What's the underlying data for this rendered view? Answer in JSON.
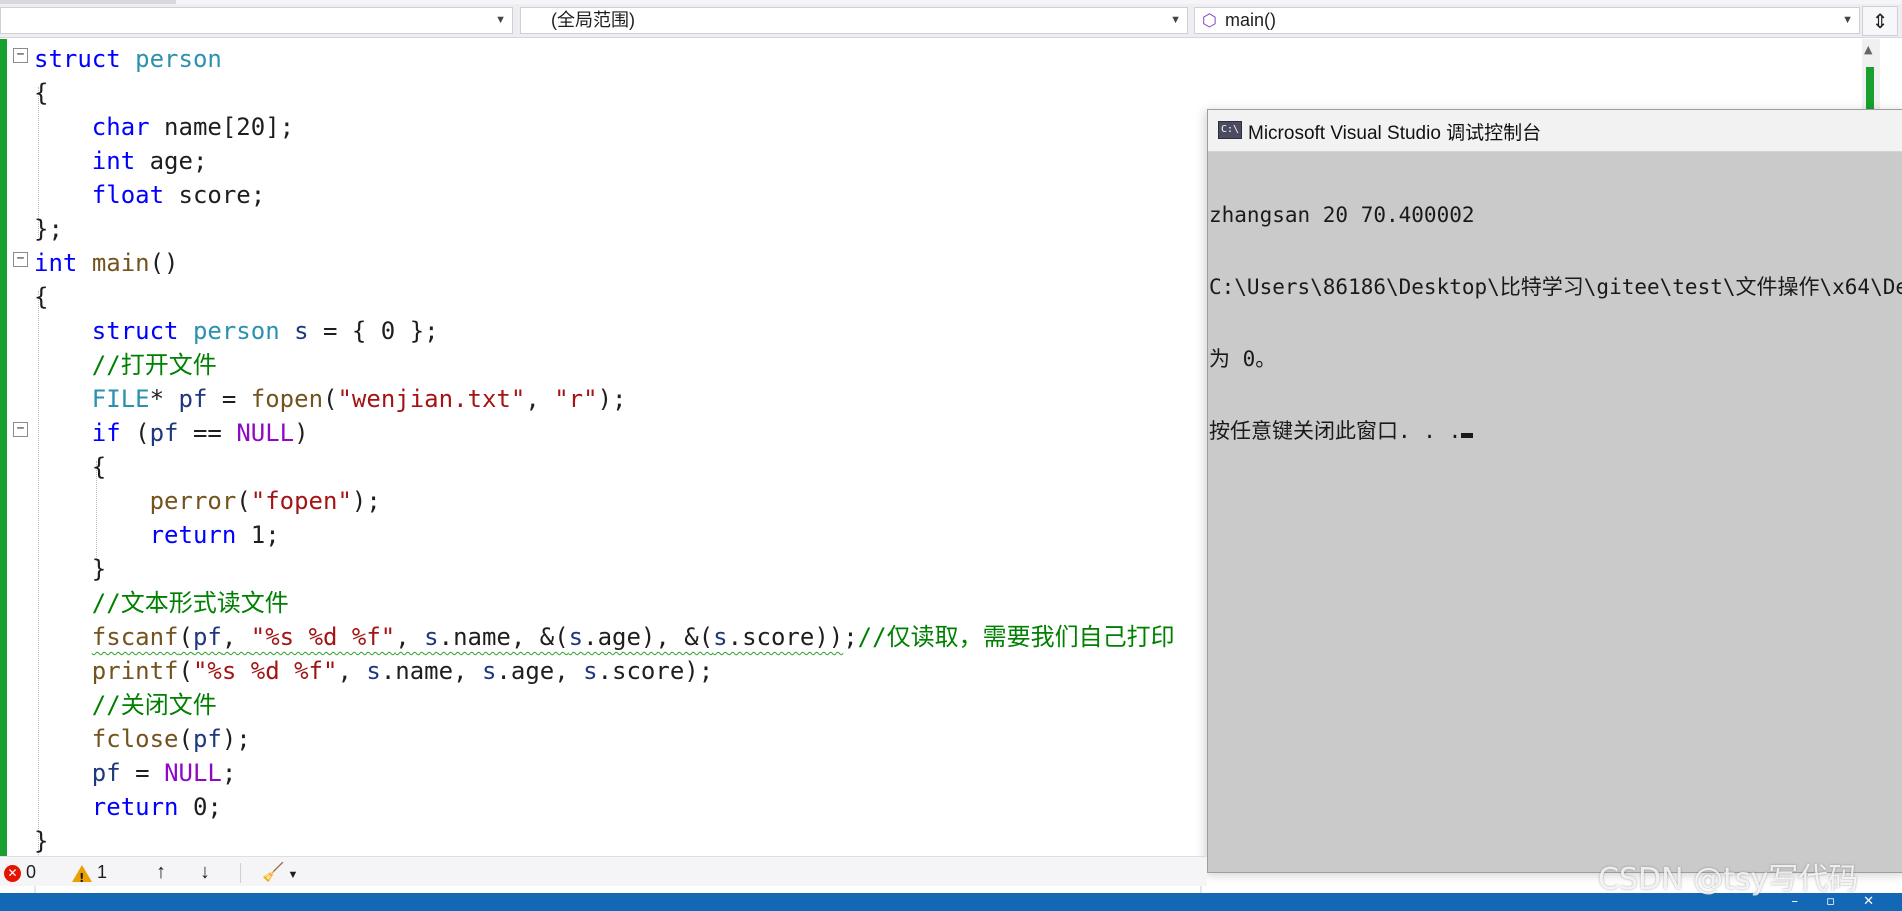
{
  "navbar": {
    "scope_value": "(全局范围)",
    "function_value": "main()",
    "split_icon": "split-window-icon"
  },
  "code_lines": [
    [
      {
        "t": "struct",
        "c": "kw"
      },
      {
        "t": " "
      },
      {
        "t": "person",
        "c": "tp"
      }
    ],
    [
      {
        "t": "{"
      }
    ],
    [
      {
        "t": "    "
      },
      {
        "t": "char",
        "c": "kw"
      },
      {
        "t": " name[20];"
      }
    ],
    [
      {
        "t": "    "
      },
      {
        "t": "int",
        "c": "kw"
      },
      {
        "t": " age;"
      }
    ],
    [
      {
        "t": "    "
      },
      {
        "t": "float",
        "c": "kw"
      },
      {
        "t": " score;"
      }
    ],
    [
      {
        "t": "};"
      }
    ],
    [
      {
        "t": "int",
        "c": "kw"
      },
      {
        "t": " "
      },
      {
        "t": "main",
        "c": "fn"
      },
      {
        "t": "()"
      }
    ],
    [
      {
        "t": "{"
      }
    ],
    [
      {
        "t": "    "
      },
      {
        "t": "struct",
        "c": "kw"
      },
      {
        "t": " "
      },
      {
        "t": "person",
        "c": "tp"
      },
      {
        "t": " "
      },
      {
        "t": "s",
        "c": "vr"
      },
      {
        "t": " = { 0 };"
      }
    ],
    [
      {
        "t": "    "
      },
      {
        "t": "//打开文件",
        "c": "cm"
      }
    ],
    [
      {
        "t": "    "
      },
      {
        "t": "FILE",
        "c": "tp"
      },
      {
        "t": "* "
      },
      {
        "t": "pf",
        "c": "vr"
      },
      {
        "t": " = "
      },
      {
        "t": "fopen",
        "c": "fn"
      },
      {
        "t": "("
      },
      {
        "t": "\"wenjian.txt\"",
        "c": "st"
      },
      {
        "t": ", "
      },
      {
        "t": "\"r\"",
        "c": "st"
      },
      {
        "t": ");"
      }
    ],
    [
      {
        "t": "    "
      },
      {
        "t": "if",
        "c": "kw"
      },
      {
        "t": " ("
      },
      {
        "t": "pf",
        "c": "vr"
      },
      {
        "t": " == "
      },
      {
        "t": "NULL",
        "c": "mc"
      },
      {
        "t": ")"
      }
    ],
    [
      {
        "t": "    {"
      }
    ],
    [
      {
        "t": "        "
      },
      {
        "t": "perror",
        "c": "fn"
      },
      {
        "t": "("
      },
      {
        "t": "\"fopen\"",
        "c": "st"
      },
      {
        "t": ");"
      }
    ],
    [
      {
        "t": "        "
      },
      {
        "t": "return",
        "c": "kw"
      },
      {
        "t": " 1;"
      }
    ],
    [
      {
        "t": "    }"
      }
    ],
    [
      {
        "t": "    "
      },
      {
        "t": "//文本形式读文件",
        "c": "cm"
      }
    ],
    [
      {
        "t": "    "
      },
      {
        "t": "fscanf",
        "c": "fn",
        "sq": true
      },
      {
        "t": "(",
        "sq": true
      },
      {
        "t": "pf",
        "c": "vr",
        "sq": true
      },
      {
        "t": ", ",
        "sq": true
      },
      {
        "t": "\"%s %d %f\"",
        "c": "st",
        "sq": true
      },
      {
        "t": ", ",
        "sq": true
      },
      {
        "t": "s",
        "c": "vr",
        "sq": true
      },
      {
        "t": ".name, &(",
        "sq": true
      },
      {
        "t": "s",
        "c": "vr",
        "sq": true
      },
      {
        "t": ".age), &(",
        "sq": true
      },
      {
        "t": "s",
        "c": "vr",
        "sq": true
      },
      {
        "t": ".score))",
        "sq": true
      },
      {
        "t": ";"
      },
      {
        "t": "//仅读取，需要我们自己打印",
        "c": "cm"
      }
    ],
    [
      {
        "t": "    "
      },
      {
        "t": "printf",
        "c": "fn"
      },
      {
        "t": "("
      },
      {
        "t": "\"%s %d %f\"",
        "c": "st"
      },
      {
        "t": ", "
      },
      {
        "t": "s",
        "c": "vr"
      },
      {
        "t": ".name, "
      },
      {
        "t": "s",
        "c": "vr"
      },
      {
        "t": ".age, "
      },
      {
        "t": "s",
        "c": "vr"
      },
      {
        "t": ".score);"
      }
    ],
    [
      {
        "t": "    "
      },
      {
        "t": "//关闭文件",
        "c": "cm"
      }
    ],
    [
      {
        "t": "    "
      },
      {
        "t": "fclose",
        "c": "fn"
      },
      {
        "t": "("
      },
      {
        "t": "pf",
        "c": "vr"
      },
      {
        "t": ");"
      }
    ],
    [
      {
        "t": "    "
      },
      {
        "t": "pf",
        "c": "vr"
      },
      {
        "t": " = "
      },
      {
        "t": "NULL",
        "c": "mc"
      },
      {
        "t": ";"
      }
    ],
    [
      {
        "t": "    "
      },
      {
        "t": "return",
        "c": "kw"
      },
      {
        "t": " 0;"
      }
    ],
    [
      {
        "t": "}"
      }
    ]
  ],
  "console": {
    "title": "Microsoft Visual Studio 调试控制台",
    "icon": "console-app-icon",
    "lines": [
      "zhangsan 20 70.400002",
      "C:\\Users\\86186\\Desktop\\比特学习\\gitee\\test\\文件操作\\x64\\De",
      "为 0。",
      "按任意键关闭此窗口. . ."
    ]
  },
  "errorbar": {
    "errors": "0",
    "warnings": "1"
  },
  "watermark": "CSDN @tsy写代码",
  "colors": {
    "keyword": "#0000ff",
    "type": "#2b91af",
    "function": "#74531f",
    "string": "#a31515",
    "comment": "#008000",
    "macro": "#8f08c4",
    "change_bar": "#17a02f",
    "status_bar": "#1268b4"
  }
}
